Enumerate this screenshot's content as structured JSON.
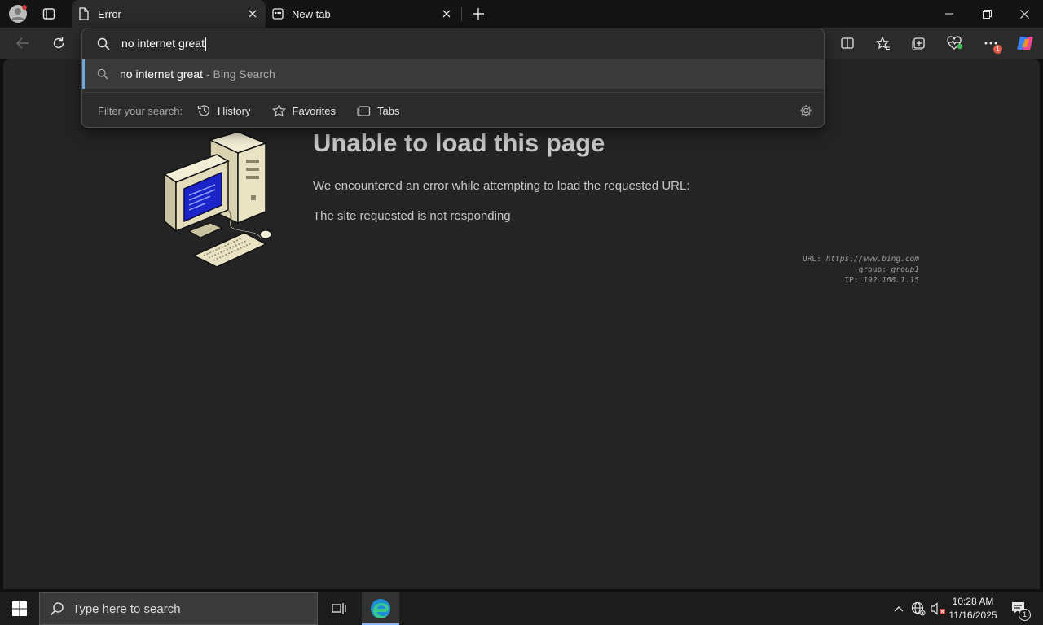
{
  "tabs": [
    {
      "label": "Error",
      "icon": "page-icon",
      "active": true
    },
    {
      "label": "New tab",
      "icon": "newtab-icon",
      "active": false
    }
  ],
  "omnibox": {
    "query": "no internet great",
    "suggestion": "no internet great",
    "suggestion_suffix": " - Bing Search",
    "filter_label": "Filter your search:",
    "filters": [
      "History",
      "Favorites",
      "Tabs"
    ]
  },
  "error": {
    "title": "Unable to load this page",
    "line1": "We encountered an error while attempting to load the requested URL:",
    "line2": "The site requested is not responding",
    "diagnostics": {
      "url_label": "URL:",
      "url_value": "https://www.bing.com",
      "group_label": "group:",
      "group_value": "group1",
      "ip_label": "IP:",
      "ip_value": "192.168.1.15"
    }
  },
  "taskbar": {
    "search_placeholder": "Type here to search",
    "time": "10:28 AM",
    "date": "11/16/2025",
    "notification_count": "1"
  },
  "toolbar": {
    "more_badge": "1"
  },
  "colors": {
    "accent": "#6fa8dc",
    "page_bg": "#242424",
    "chrome_bg": "#2b2b2b"
  }
}
